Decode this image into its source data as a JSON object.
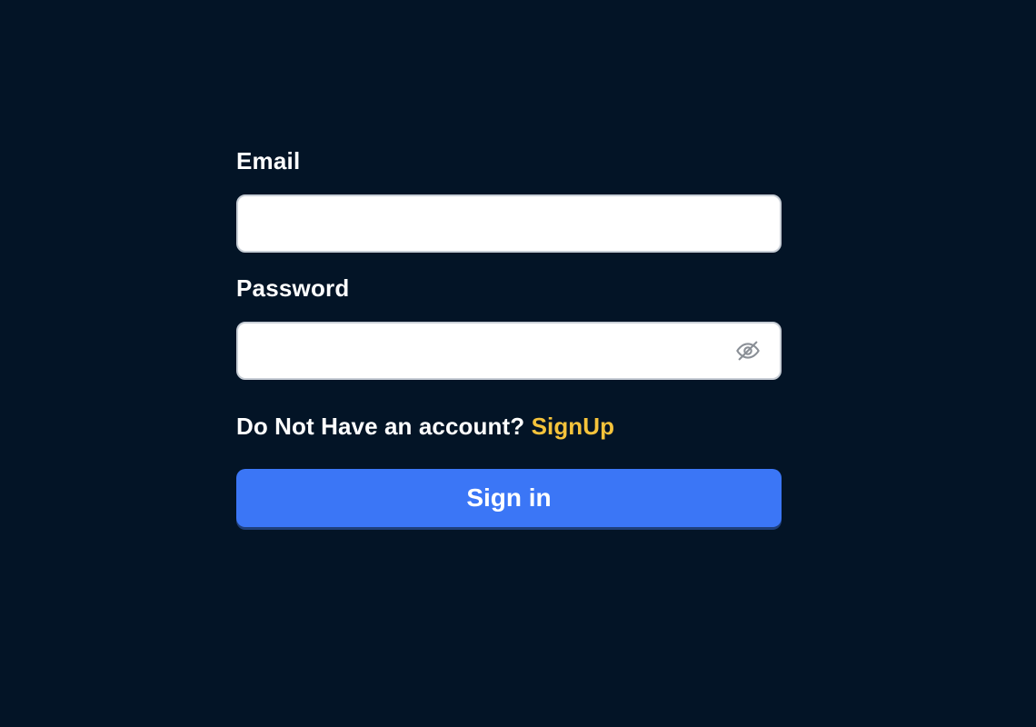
{
  "form": {
    "email_label": "Email",
    "email_value": "",
    "password_label": "Password",
    "password_value": "",
    "password_toggle_icon": "eye-off-icon",
    "signup_prompt": "Do Not Have an account?",
    "signup_link": "SignUp",
    "submit_label": "Sign in"
  },
  "colors": {
    "background": "#031426",
    "label_text": "#ffffff",
    "link": "#f5c33b",
    "button": "#3b76f6",
    "input_border": "#c8ced6"
  }
}
